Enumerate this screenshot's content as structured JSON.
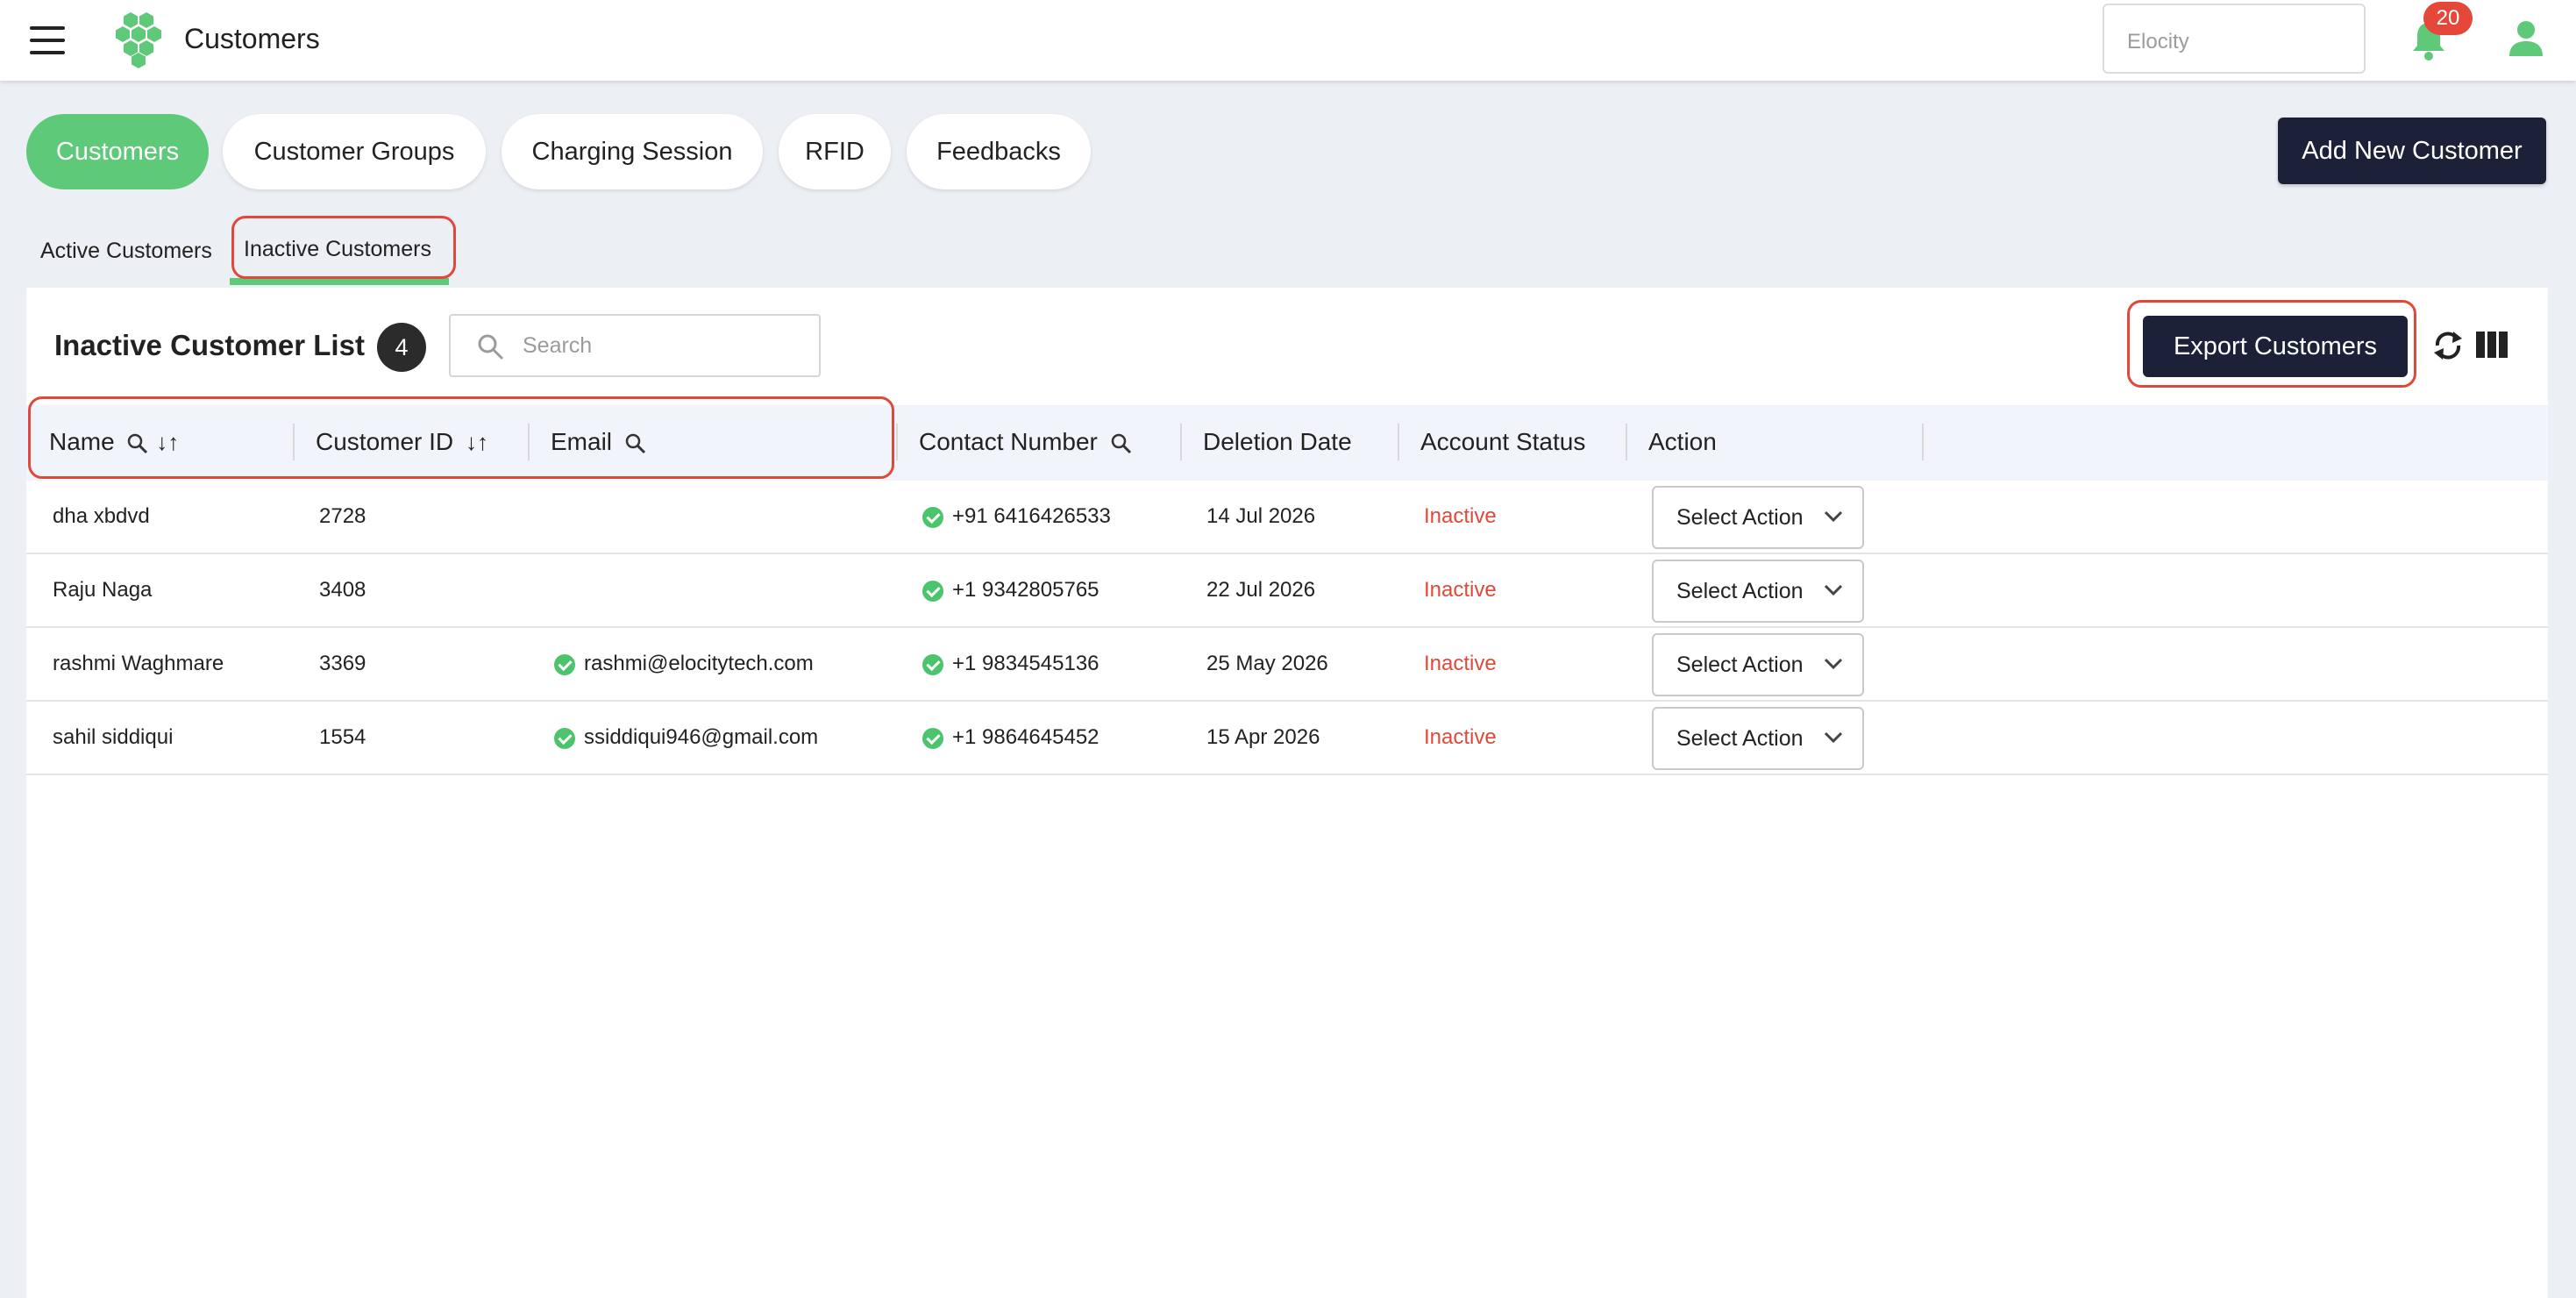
{
  "header": {
    "title": "Customers",
    "org_placeholder": "Elocity",
    "notification_count": "20"
  },
  "main_tabs": [
    {
      "label": "Customers",
      "active": true
    },
    {
      "label": "Customer Groups",
      "active": false
    },
    {
      "label": "Charging Session",
      "active": false
    },
    {
      "label": "RFID",
      "active": false
    },
    {
      "label": "Feedbacks",
      "active": false
    }
  ],
  "add_button_label": "Add New Customer",
  "sub_tabs": [
    {
      "label": "Active Customers",
      "active": false
    },
    {
      "label": "Inactive Customers",
      "active": true
    }
  ],
  "list": {
    "title": "Inactive Customer List",
    "count": "4",
    "search_placeholder": "Search",
    "export_label": "Export Customers"
  },
  "columns": [
    {
      "label": "Name",
      "search": true,
      "sort": true
    },
    {
      "label": "Customer ID",
      "search": false,
      "sort": true
    },
    {
      "label": "Email",
      "search": true,
      "sort": false
    },
    {
      "label": "Contact Number",
      "search": true,
      "sort": false
    },
    {
      "label": "Deletion Date",
      "search": false,
      "sort": false
    },
    {
      "label": "Account Status",
      "search": false,
      "sort": false
    },
    {
      "label": "Action",
      "search": false,
      "sort": false
    }
  ],
  "rows": [
    {
      "name": "dha xbdvd",
      "customer_id": "2728",
      "email": "",
      "contact": "+91 6416426533",
      "deletion_date": "14 Jul 2026",
      "status": "Inactive",
      "action": "Select Action"
    },
    {
      "name": "Raju Naga",
      "customer_id": "3408",
      "email": "",
      "contact": "+1 9342805765",
      "deletion_date": "22 Jul 2026",
      "status": "Inactive",
      "action": "Select Action"
    },
    {
      "name": "rashmi Waghmare",
      "customer_id": "3369",
      "email": "rashmi@elocitytech.com",
      "contact": "+1 9834545136",
      "deletion_date": "25 May 2026",
      "status": "Inactive",
      "action": "Select Action"
    },
    {
      "name": "sahil siddiqui",
      "customer_id": "1554",
      "email": "ssiddiqui946@gmail.com",
      "contact": "+1 9864645452",
      "deletion_date": "15 Apr 2026",
      "status": "Inactive",
      "action": "Select Action"
    }
  ],
  "colors": {
    "accent_green": "#5fc97a",
    "dark_button": "#1c2138",
    "inactive_red": "#e0493a",
    "annotation_red": "#e0493a"
  }
}
